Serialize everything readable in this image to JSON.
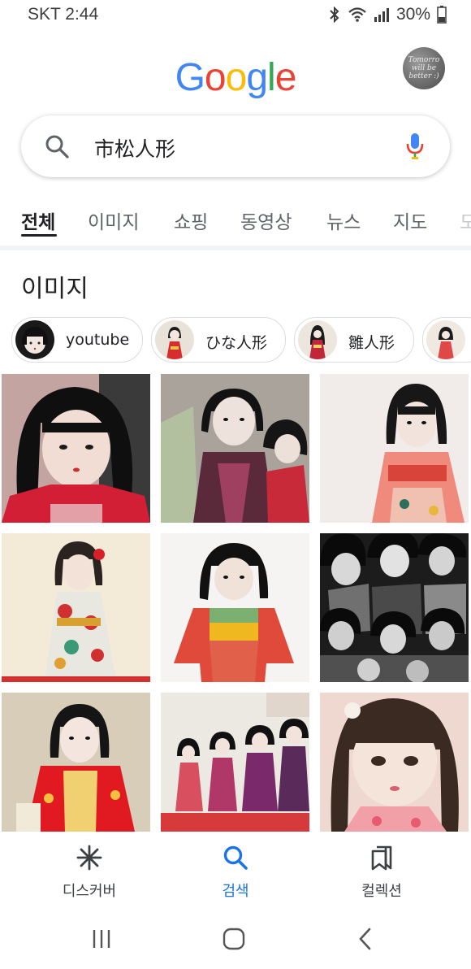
{
  "status_bar": {
    "carrier_time": "SKT 2:44",
    "battery": "30%",
    "icons": [
      "bluetooth-icon",
      "wifi-icon",
      "signal-icon",
      "battery-icon"
    ]
  },
  "logo": {
    "letters": [
      "G",
      "o",
      "o",
      "g",
      "l",
      "e"
    ],
    "colors": [
      "#4285F4",
      "#EA4335",
      "#FBBC05",
      "#4285F4",
      "#34A853",
      "#EA4335"
    ]
  },
  "avatar": {
    "lines": [
      "Tomorro",
      "will be",
      "better :)"
    ]
  },
  "search": {
    "query": "市松人形"
  },
  "tabs": [
    "전체",
    "이미지",
    "쇼핑",
    "동영상",
    "뉴스",
    "지도",
    "도"
  ],
  "section": {
    "title": "이미지"
  },
  "chips": [
    "youtube",
    "ひな人形",
    "雛人形"
  ],
  "bottom_nav": [
    {
      "label": "디스커버",
      "icon": "discover-asterisk-icon"
    },
    {
      "label": "검색",
      "icon": "search-icon"
    },
    {
      "label": "컬렉션",
      "icon": "collections-icon"
    }
  ],
  "colors": {
    "accent": "#1a73e8",
    "text": "#202124",
    "muted": "#5f6368"
  }
}
